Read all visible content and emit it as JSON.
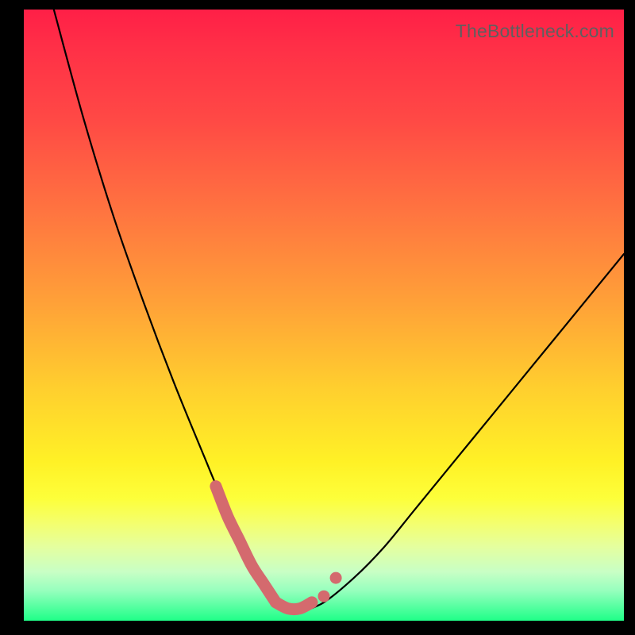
{
  "watermark": "TheBottleneck.com",
  "colors": {
    "frame_border": "#000000",
    "curve_stroke": "#000000",
    "marker_stroke": "#d46a6e",
    "gradient_top": "#ff1f47",
    "gradient_bottom": "#1fff88"
  },
  "chart_data": {
    "type": "line",
    "title": "",
    "xlabel": "",
    "ylabel": "",
    "xlim": [
      0,
      100
    ],
    "ylim": [
      0,
      100
    ],
    "grid": false,
    "series": [
      {
        "name": "bottleneck-curve",
        "x": [
          5,
          10,
          15,
          20,
          25,
          30,
          33,
          36,
          38,
          40,
          42,
          44,
          46,
          50,
          55,
          60,
          65,
          70,
          75,
          80,
          85,
          90,
          95,
          100
        ],
        "values": [
          100,
          82,
          66,
          52,
          39,
          27,
          20,
          14,
          10,
          6,
          3,
          1.5,
          1.5,
          3,
          7,
          12,
          18,
          24,
          30,
          36,
          42,
          48,
          54,
          60
        ]
      },
      {
        "name": "highlight-dots",
        "x": [
          32,
          34,
          36,
          38,
          40,
          42,
          44,
          46,
          48,
          50,
          52
        ],
        "values": [
          22,
          17,
          13,
          9,
          6,
          3,
          2,
          2,
          3,
          4,
          7
        ]
      }
    ]
  }
}
